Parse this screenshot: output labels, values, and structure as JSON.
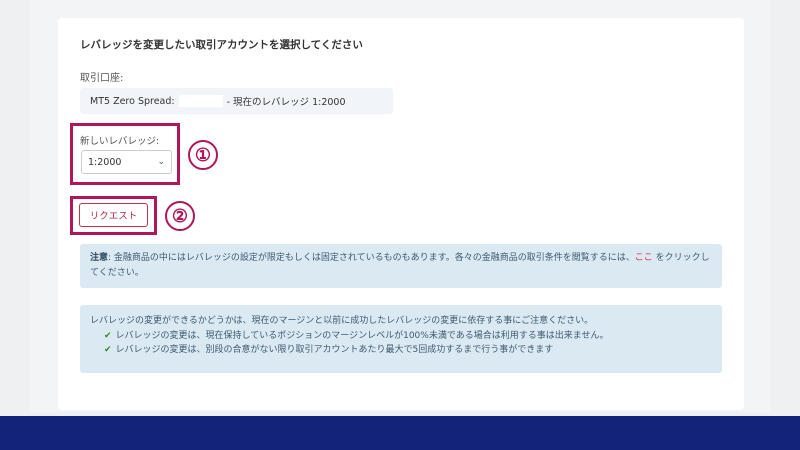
{
  "form": {
    "title": "レバレッジを変更したい取引アカウントを選択してください",
    "account_label": "取引口座:",
    "account_name": "MT5 Zero Spread:",
    "account_current": "- 現在のレバレッジ 1:2000",
    "leverage_label": "新しいレバレッジ:",
    "leverage_value": "1:2000",
    "request_button": "リクエスト"
  },
  "markers": {
    "one": "①",
    "two": "②"
  },
  "note1": {
    "bold": "注意",
    "text_a": ": 金融商品の中にはレバレッジの設定が限定もしくは固定されているものもあります。各々の金融商品の取引条件を閲覧するには、",
    "link": "ここ",
    "text_b": " をクリックしてください。"
  },
  "note2": {
    "intro": "レバレッジの変更ができるかどうかは、現在のマージンと以前に成功したレバレッジの変更に依存する事にご注意ください。",
    "items": [
      "レバレッジの変更は、現在保持しているポジションのマージンレベルが100%未満である場合は利用する事は出来ません。",
      "レバレッジの変更は、別段の合意がない限り取引アカウントあたり最大で5回成功するまで行う事ができます"
    ]
  },
  "colors": {
    "highlight": "#b0165a",
    "footer": "#13237a",
    "note_bg": "#dbe9f3",
    "check": "#2e8b2e"
  }
}
